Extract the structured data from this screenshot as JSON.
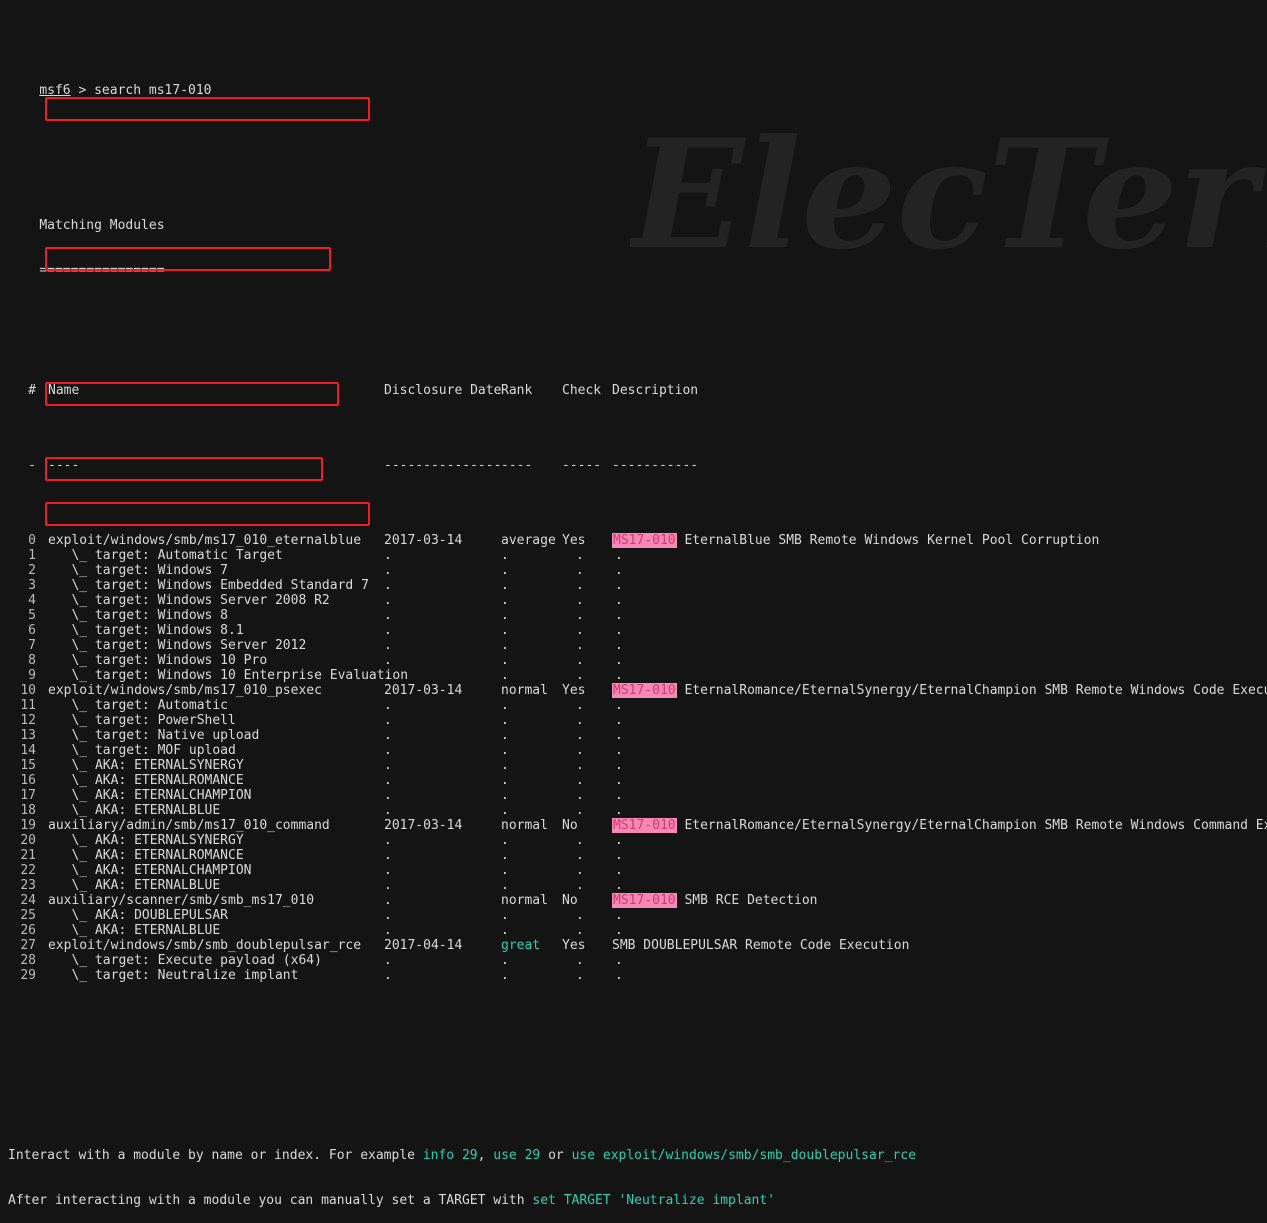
{
  "terminal": {
    "background_color": "#141414",
    "foreground_color": "#cfd0d0",
    "accent_cyan": "#23d1b0",
    "cve_badge_bg": "#f988b6",
    "cve_badge_fg": "#d23a72",
    "annotation_color": "#ee1c25",
    "watermark_text": "ElecTerm"
  },
  "prompt": {
    "user": "msf6",
    "symbol": ">",
    "command": "search ms17-010"
  },
  "section": {
    "title": "Matching Modules",
    "underline": "================"
  },
  "table": {
    "headers": {
      "index": "#",
      "name": "Name",
      "disclosure_date": "Disclosure Date",
      "rank": "Rank",
      "check": "Check",
      "description": "Description"
    },
    "rules": {
      "index": "-",
      "name": "----",
      "disclosure_date": "---------------",
      "rank": "----",
      "check": "-----",
      "description": "-----------"
    },
    "rows": [
      {
        "index": "0",
        "name": "exploit/windows/smb/ms17_010_eternalblue",
        "date": "2017-03-14",
        "rank": "average",
        "rank_color": "default",
        "check": "Yes",
        "cve": "MS17-010",
        "description": "EternalBlue SMB Remote Windows Kernel Pool Corruption",
        "boxed": true,
        "module": true
      },
      {
        "index": "1",
        "name": "\\_ target: Automatic Target",
        "date": ".",
        "rank": ".",
        "check": ".",
        "description": ".",
        "boxed": false,
        "module": false
      },
      {
        "index": "2",
        "name": "\\_ target: Windows 7",
        "date": ".",
        "rank": ".",
        "check": ".",
        "description": ".",
        "boxed": false,
        "module": false
      },
      {
        "index": "3",
        "name": "\\_ target: Windows Embedded Standard 7",
        "date": ".",
        "rank": ".",
        "check": ".",
        "description": ".",
        "boxed": false,
        "module": false
      },
      {
        "index": "4",
        "name": "\\_ target: Windows Server 2008 R2",
        "date": ".",
        "rank": ".",
        "check": ".",
        "description": ".",
        "boxed": false,
        "module": false
      },
      {
        "index": "5",
        "name": "\\_ target: Windows 8",
        "date": ".",
        "rank": ".",
        "check": ".",
        "description": ".",
        "boxed": false,
        "module": false
      },
      {
        "index": "6",
        "name": "\\_ target: Windows 8.1",
        "date": ".",
        "rank": ".",
        "check": ".",
        "description": ".",
        "boxed": false,
        "module": false
      },
      {
        "index": "7",
        "name": "\\_ target: Windows Server 2012",
        "date": ".",
        "rank": ".",
        "check": ".",
        "description": ".",
        "boxed": false,
        "module": false
      },
      {
        "index": "8",
        "name": "\\_ target: Windows 10 Pro",
        "date": ".",
        "rank": ".",
        "check": ".",
        "description": ".",
        "boxed": false,
        "module": false
      },
      {
        "index": "9",
        "name": "\\_ target: Windows 10 Enterprise Evaluation",
        "date": ".",
        "rank": ".",
        "check": ".",
        "description": ".",
        "boxed": false,
        "module": false
      },
      {
        "index": "10",
        "name": "exploit/windows/smb/ms17_010_psexec",
        "date": "2017-03-14",
        "rank": "normal",
        "rank_color": "default",
        "check": "Yes",
        "cve": "MS17-010",
        "description": "EternalRomance/EternalSynergy/EternalChampion SMB Remote Windows Code Execution",
        "boxed": true,
        "module": true
      },
      {
        "index": "11",
        "name": "\\_ target: Automatic",
        "date": ".",
        "rank": ".",
        "check": ".",
        "description": ".",
        "boxed": false,
        "module": false
      },
      {
        "index": "12",
        "name": "\\_ target: PowerShell",
        "date": ".",
        "rank": ".",
        "check": ".",
        "description": ".",
        "boxed": false,
        "module": false
      },
      {
        "index": "13",
        "name": "\\_ target: Native upload",
        "date": ".",
        "rank": ".",
        "check": ".",
        "description": ".",
        "boxed": false,
        "module": false
      },
      {
        "index": "14",
        "name": "\\_ target: MOF upload",
        "date": ".",
        "rank": ".",
        "check": ".",
        "description": ".",
        "boxed": false,
        "module": false
      },
      {
        "index": "15",
        "name": "\\_ AKA: ETERNALSYNERGY",
        "date": ".",
        "rank": ".",
        "check": ".",
        "description": ".",
        "boxed": false,
        "module": false
      },
      {
        "index": "16",
        "name": "\\_ AKA: ETERNALROMANCE",
        "date": ".",
        "rank": ".",
        "check": ".",
        "description": ".",
        "boxed": false,
        "module": false
      },
      {
        "index": "17",
        "name": "\\_ AKA: ETERNALCHAMPION",
        "date": ".",
        "rank": ".",
        "check": ".",
        "description": ".",
        "boxed": false,
        "module": false
      },
      {
        "index": "18",
        "name": "\\_ AKA: ETERNALBLUE",
        "date": ".",
        "rank": ".",
        "check": ".",
        "description": ".",
        "boxed": false,
        "module": false
      },
      {
        "index": "19",
        "name": "auxiliary/admin/smb/ms17_010_command",
        "date": "2017-03-14",
        "rank": "normal",
        "rank_color": "default",
        "check": "No",
        "cve": "MS17-010",
        "description": "EternalRomance/EternalSynergy/EternalChampion SMB Remote Windows Command Execution",
        "boxed": true,
        "module": true
      },
      {
        "index": "20",
        "name": "\\_ AKA: ETERNALSYNERGY",
        "date": ".",
        "rank": ".",
        "check": ".",
        "description": ".",
        "boxed": false,
        "module": false
      },
      {
        "index": "21",
        "name": "\\_ AKA: ETERNALROMANCE",
        "date": ".",
        "rank": ".",
        "check": ".",
        "description": ".",
        "boxed": false,
        "module": false
      },
      {
        "index": "22",
        "name": "\\_ AKA: ETERNALCHAMPION",
        "date": ".",
        "rank": ".",
        "check": ".",
        "description": ".",
        "boxed": false,
        "module": false
      },
      {
        "index": "23",
        "name": "\\_ AKA: ETERNALBLUE",
        "date": ".",
        "rank": ".",
        "check": ".",
        "description": ".",
        "boxed": false,
        "module": false
      },
      {
        "index": "24",
        "name": "auxiliary/scanner/smb/smb_ms17_010",
        "date": ".",
        "rank": "normal",
        "rank_color": "default",
        "check": "No",
        "cve": "MS17-010",
        "description": "SMB RCE Detection",
        "boxed": true,
        "module": true
      },
      {
        "index": "25",
        "name": "\\_ AKA: DOUBLEPULSAR",
        "date": ".",
        "rank": ".",
        "check": ".",
        "description": ".",
        "boxed": false,
        "module": false
      },
      {
        "index": "26",
        "name": "\\_ AKA: ETERNALBLUE",
        "date": ".",
        "rank": ".",
        "check": ".",
        "description": ".",
        "boxed": false,
        "module": false
      },
      {
        "index": "27",
        "name": "exploit/windows/smb/smb_doublepulsar_rce",
        "date": "2017-04-14",
        "rank": "great",
        "rank_color": "cyan",
        "check": "Yes",
        "cve": "",
        "description": "SMB DOUBLEPULSAR Remote Code Execution",
        "boxed": true,
        "module": true
      },
      {
        "index": "28",
        "name": "\\_ target: Execute payload (x64)",
        "date": ".",
        "rank": ".",
        "check": ".",
        "description": ".",
        "boxed": false,
        "module": false
      },
      {
        "index": "29",
        "name": "\\_ target: Neutralize implant",
        "date": ".",
        "rank": ".",
        "check": ".",
        "description": ".",
        "boxed": false,
        "module": false
      }
    ]
  },
  "footer": {
    "line1": [
      {
        "text": "Interact with a module by name or index. For example ",
        "color": "default"
      },
      {
        "text": "info 29",
        "color": "cyan"
      },
      {
        "text": ", ",
        "color": "default"
      },
      {
        "text": "use 29",
        "color": "cyan"
      },
      {
        "text": " or ",
        "color": "default"
      },
      {
        "text": "use exploit/windows/smb/smb_doublepulsar_rce",
        "color": "cyan"
      }
    ],
    "line2": [
      {
        "text": "After interacting with a module you can manually set a TARGET with ",
        "color": "default"
      },
      {
        "text": "set TARGET 'Neutralize implant'",
        "color": "cyan"
      }
    ]
  }
}
